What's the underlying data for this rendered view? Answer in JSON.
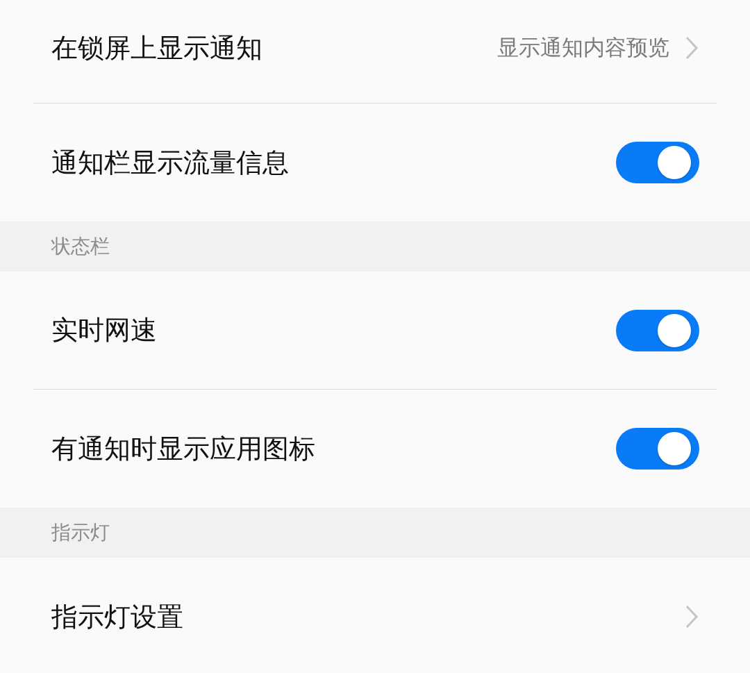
{
  "items": [
    {
      "kind": "link",
      "label": "在锁屏上显示通知",
      "value": "显示通知内容预览"
    },
    {
      "kind": "toggle",
      "label": "通知栏显示流量信息",
      "on": true
    },
    {
      "kind": "header",
      "label": "状态栏"
    },
    {
      "kind": "toggle",
      "label": "实时网速",
      "on": true
    },
    {
      "kind": "toggle",
      "label": "有通知时显示应用图标",
      "on": true
    },
    {
      "kind": "header",
      "label": "指示灯"
    },
    {
      "kind": "link",
      "label": "指示灯设置"
    }
  ]
}
